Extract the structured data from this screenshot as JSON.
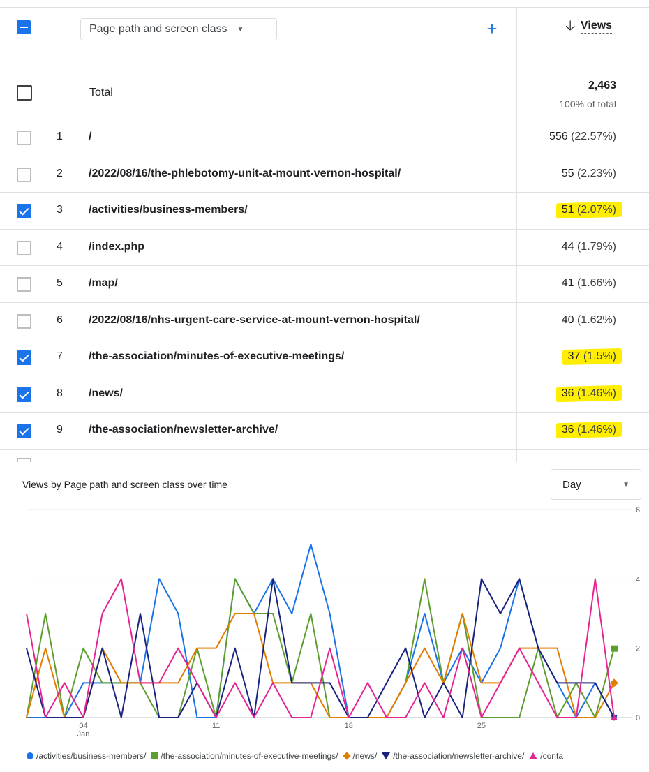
{
  "table": {
    "dimension_label": "Page path and screen class",
    "add_dimension": "+",
    "metric_label": "Views",
    "sort_icon": "arrow-down-icon",
    "total": {
      "label": "Total",
      "value": "2,463",
      "pct": "100% of total"
    },
    "rows": [
      {
        "index": "1",
        "path": "/",
        "value": "556",
        "pct": "(22.57%)",
        "checked": false,
        "highlighted": false
      },
      {
        "index": "2",
        "path": "/2022/08/16/the-phlebotomy-unit-at-mount-vernon-hospital/",
        "value": "55",
        "pct": "(2.23%)",
        "checked": false,
        "highlighted": false
      },
      {
        "index": "3",
        "path": "/activities/business-members/",
        "value": "51",
        "pct": "(2.07%)",
        "checked": true,
        "highlighted": true
      },
      {
        "index": "4",
        "path": "/index.php",
        "value": "44",
        "pct": "(1.79%)",
        "checked": false,
        "highlighted": false
      },
      {
        "index": "5",
        "path": "/map/",
        "value": "41",
        "pct": "(1.66%)",
        "checked": false,
        "highlighted": false
      },
      {
        "index": "6",
        "path": "/2022/08/16/nhs-urgent-care-service-at-mount-vernon-hospital/",
        "value": "40",
        "pct": "(1.62%)",
        "checked": false,
        "highlighted": false
      },
      {
        "index": "7",
        "path": "/the-association/minutes-of-executive-meetings/",
        "value": "37",
        "pct": "(1.5%)",
        "checked": true,
        "highlighted": true
      },
      {
        "index": "8",
        "path": "/news/",
        "value": "36",
        "pct": "(1.46%)",
        "checked": true,
        "highlighted": true
      },
      {
        "index": "9",
        "path": "/the-association/newsletter-archive/",
        "value": "36",
        "pct": "(1.46%)",
        "checked": true,
        "highlighted": true
      }
    ]
  },
  "chart_section": {
    "title": "Views by Page path and screen class over time",
    "granularity": "Day",
    "highlight_color": "#ffee00",
    "accent_color": "#1a73e8"
  },
  "chart_data": {
    "type": "line",
    "x_ticks": [
      {
        "day": 4,
        "label": "04",
        "sublabel": "Jan"
      },
      {
        "day": 11,
        "label": "11",
        "sublabel": ""
      },
      {
        "day": 18,
        "label": "18",
        "sublabel": ""
      },
      {
        "day": 25,
        "label": "25",
        "sublabel": ""
      }
    ],
    "x": [
      1,
      2,
      3,
      4,
      5,
      6,
      7,
      8,
      9,
      10,
      11,
      12,
      13,
      14,
      15,
      16,
      17,
      18,
      19,
      20,
      21,
      22,
      23,
      24,
      25,
      26,
      27,
      28,
      29,
      30,
      31
    ],
    "ylim": [
      0,
      6
    ],
    "y_ticks": [
      0,
      2,
      4,
      6
    ],
    "grid": true,
    "legend_position": "bottom",
    "series": [
      {
        "name": "/activities/business-members/",
        "color": "#1a73e8",
        "marker": "circle",
        "values": [
          0,
          0,
          0,
          1,
          1,
          1,
          1,
          4,
          3,
          0,
          0,
          4,
          3,
          4,
          3,
          5,
          3,
          0,
          0,
          0,
          1,
          3,
          1,
          2,
          1,
          2,
          4,
          2,
          1,
          0,
          1,
          0
        ]
      },
      {
        "name": "/the-association/minutes-of-executive-meetings/",
        "color": "#5e9e2f",
        "marker": "square",
        "values": [
          0,
          3,
          0,
          2,
          1,
          1,
          1,
          0,
          0,
          2,
          0,
          4,
          3,
          3,
          1,
          3,
          0,
          0,
          0,
          0,
          1,
          4,
          1,
          3,
          0,
          0,
          0,
          2,
          0,
          1,
          0,
          2
        ]
      },
      {
        "name": "/news/",
        "color": "#e37d00",
        "marker": "diamond",
        "values": [
          0,
          2,
          0,
          0,
          2,
          1,
          1,
          1,
          1,
          2,
          2,
          3,
          3,
          1,
          1,
          1,
          0,
          0,
          0,
          0,
          1,
          2,
          1,
          3,
          1,
          1,
          2,
          2,
          2,
          0,
          0,
          1
        ]
      },
      {
        "name": "/the-association/newsletter-archive/",
        "color": "#1a237e",
        "marker": "triangle-down",
        "values": [
          2,
          0,
          0,
          0,
          2,
          0,
          3,
          0,
          0,
          1,
          0,
          2,
          0,
          4,
          1,
          1,
          1,
          0,
          0,
          1,
          2,
          0,
          1,
          0,
          4,
          3,
          4,
          2,
          1,
          1,
          1,
          0
        ]
      },
      {
        "name": "/conta",
        "color": "#e52592",
        "marker": "triangle-up",
        "values": [
          3,
          0,
          1,
          0,
          3,
          4,
          1,
          1,
          2,
          1,
          0,
          1,
          0,
          1,
          0,
          0,
          2,
          0,
          1,
          0,
          0,
          1,
          0,
          2,
          0,
          1,
          2,
          1,
          0,
          0,
          4,
          0
        ]
      }
    ]
  }
}
